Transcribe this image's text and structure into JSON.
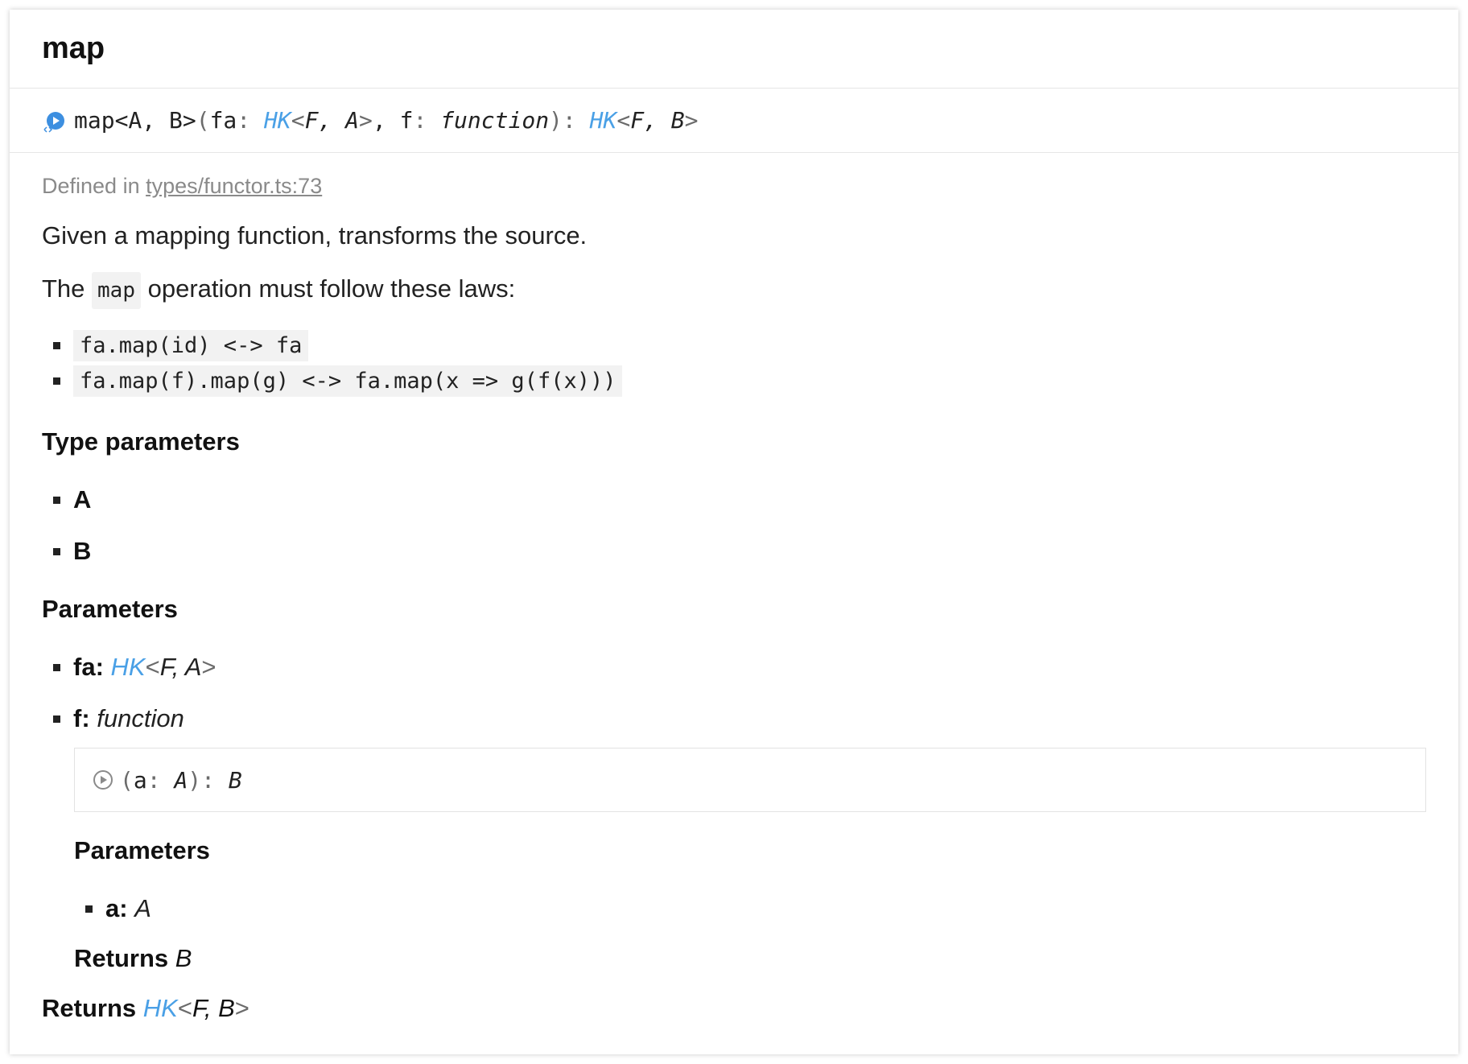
{
  "title": "map",
  "signature": {
    "name": "map<A, B>",
    "open": "(",
    "p1_name": "fa",
    "colon": ": ",
    "p1_hk": "HK",
    "p1_lt": "<",
    "p1_args": "F, A",
    "p1_gt": ">",
    "sep": ", ",
    "p2_name": "f",
    "p2_type": "function",
    "close": "): ",
    "ret_hk": "HK",
    "ret_lt": "<",
    "ret_args": "F, B",
    "ret_gt": ">"
  },
  "defined_prefix": "Defined in ",
  "defined_link": "types/functor.ts:73",
  "description": "Given a mapping function, transforms the source.",
  "laws_intro": {
    "before": "The ",
    "code": "map",
    "after": " operation must follow these laws:"
  },
  "laws": [
    "fa.map(id) <-> fa",
    "fa.map(f).map(g) <-> fa.map(x => g(f(x)))"
  ],
  "type_params_heading": "Type parameters",
  "type_params": [
    "A",
    "B"
  ],
  "params_heading": "Parameters",
  "param_fa": {
    "name": "fa:",
    "hk": "HK",
    "lt": "<",
    "args": "F, A",
    "gt": ">"
  },
  "param_f": {
    "name": "f:",
    "type": "function"
  },
  "fn_sig": {
    "open": "(",
    "param": "a",
    "colon": ": ",
    "type": "A",
    "close": "): ",
    "ret": "B"
  },
  "nested_params_heading": "Parameters",
  "nested_param": {
    "name": "a:",
    "type": "A"
  },
  "nested_returns": {
    "label": "Returns",
    "type": "B"
  },
  "returns": {
    "label": "Returns",
    "hk": "HK",
    "lt": "<",
    "args": "F, B",
    "gt": ">"
  },
  "colors": {
    "link_type": "#4aa0e6",
    "icon": "#3d8fe0",
    "muted": "#8a8a8a"
  }
}
